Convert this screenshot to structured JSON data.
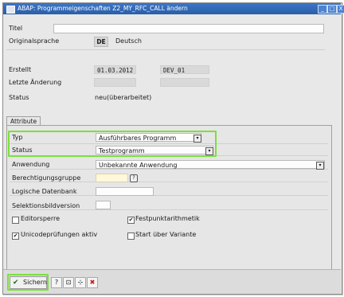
{
  "window": {
    "title": "ABAP: Programmeigenschaften Z2_MY_RFC_CALL ändern",
    "buttons": [
      "_",
      "□",
      "X"
    ]
  },
  "header": {
    "titel_label": "Titel",
    "titel_value": "",
    "originalsprache_label": "Originalsprache",
    "originalsprache_code": "DE",
    "originalsprache_name": "Deutsch",
    "erstellt_label": "Erstellt",
    "erstellt_date": "01.03.2012",
    "erstellt_user": "DEV_01",
    "letzte_aenderung_label": "Letzte Änderung",
    "status_label": "Status",
    "status_value": "neu(überarbeitet)"
  },
  "attribute": {
    "tab_label": "Attribute",
    "typ_label": "Typ",
    "typ_value": "Ausführbares Programm",
    "status_label": "Status",
    "status_value": "Testprogramm",
    "anwendung_label": "Anwendung",
    "anwendung_value": "Unbekannte Anwendung",
    "berechtigungsgruppe_label": "Berechtigungsgruppe",
    "logische_datenbank_label": "Logische Datenbank",
    "selektionsbildversion_label": "Selektionsbildversion",
    "checkboxes": [
      {
        "label": "Editorsperre",
        "checked": false
      },
      {
        "label": "Festpunktarithmetik",
        "checked": true
      },
      {
        "label": "Unicodeprüfungen aktiv",
        "checked": true
      },
      {
        "label": "Start über Variante",
        "checked": false
      }
    ]
  },
  "toolbar": {
    "save_label": "Sichern",
    "check_mark": "✔",
    "icons": [
      "help-icon",
      "display-icon",
      "tree-icon",
      "cancel-icon"
    ],
    "cancel_glyph": "✖"
  },
  "colors": {
    "highlight": "#7be03b",
    "titlebar": "#2a5ea8"
  }
}
